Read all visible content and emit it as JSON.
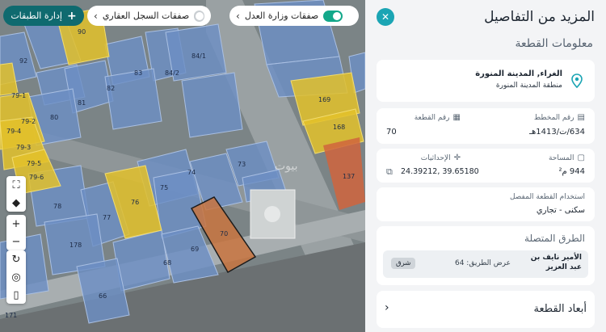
{
  "map": {
    "layers_button_label": "إدارة الطبقات",
    "registry_toggle_label": "صفقات السجل العقاري",
    "moj_toggle_label": "صفقات وزارة العدل",
    "watermark": "بيوت",
    "parcel_labels": [
      "90",
      "92",
      "83",
      "84/2",
      "84/1",
      "81",
      "82",
      "80",
      "79-1",
      "79-2",
      "79-3",
      "79-4",
      "79-5",
      "79-6",
      "78",
      "76",
      "77",
      "75",
      "74",
      "73",
      "70",
      "69",
      "68",
      "66",
      "178",
      "171",
      "137",
      "168",
      "169"
    ]
  },
  "panel": {
    "title": "المزيد من التفاصيل",
    "section_title": "معلومات القطعة",
    "location": {
      "title": "الغراء, المدينة المنورة",
      "subtitle": "منطقة المدينة المنورة"
    },
    "plan_number": {
      "label": "رقم المخطط",
      "value": "634/ت/1413هـ"
    },
    "plot_number": {
      "label": "رقم القطعة",
      "value": "70"
    },
    "area": {
      "label": "المساحة",
      "value": "944 م²"
    },
    "coordinates": {
      "label": "الإحداثيات",
      "value": "39.65180 ,24.39212"
    },
    "usage": {
      "label": "استخدام القطعة المفصل",
      "value": "سكنى - تجاري"
    },
    "roads": {
      "title": "الطرق المتصلة",
      "items": [
        {
          "name": "الأمير نايف بن عبد العزيز",
          "width": "عرض الطريق: 64",
          "direction": "شرق"
        }
      ]
    },
    "dimensions_title": "أبعاد القطعة"
  },
  "colors": {
    "accent": "#1ba5b4",
    "toggle_on": "#13a88a",
    "selected_parcel": "#c9743f",
    "highlight_parcel": "#e3c12a",
    "parcel_blue": "#6d8fc4"
  }
}
